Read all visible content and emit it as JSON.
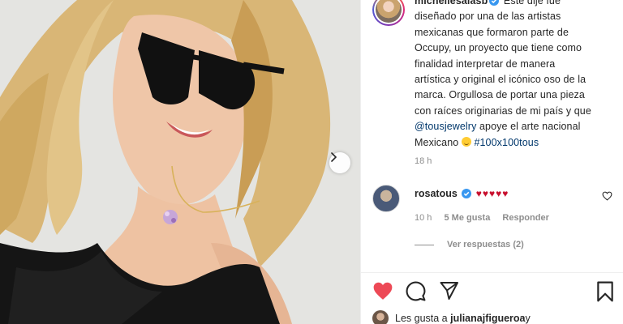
{
  "post": {
    "username": "michellesalasb",
    "caption_lines": [
      " Este dije fue",
      "diseñado por una de las artistas",
      "mexicanas que formaron parte de",
      "Occupy, un proyecto que tiene como",
      "finalidad interpretar de manera",
      "artística y original el icónico oso de la",
      "marca. Orgullosa de portar una pieza",
      "con raíces originarias de mi país y que"
    ],
    "mention": "@tousjewelry",
    "line9_rest": " apoye el arte nacional",
    "line10_text": "Mexicano ",
    "hashtag": "#100x100tous",
    "time": "18 h"
  },
  "comment": {
    "username": "rosatous",
    "text": "♥♥♥♥♥",
    "time": "10 h",
    "likes": "5 Me gusta",
    "reply_label": "Responder",
    "view_replies": "Ver respuestas (2)"
  },
  "footer": {
    "likes_prefix": "Les gusta a ",
    "likes_user": "julianajfigueroa",
    "likes_suffix": " y"
  },
  "colors": {
    "like_red": "#ed4956",
    "verified_blue": "#3897f0",
    "link_blue": "#00376b",
    "muted_gray": "#8e8e8e",
    "hearts_red": "#c8102e"
  },
  "icons": {
    "next": "chevron-right-icon",
    "verified": "verified-badge-icon",
    "like_small": "heart-outline-icon",
    "like": "heart-filled-icon",
    "comment": "comment-icon",
    "share": "paper-plane-icon",
    "save": "bookmark-icon"
  }
}
